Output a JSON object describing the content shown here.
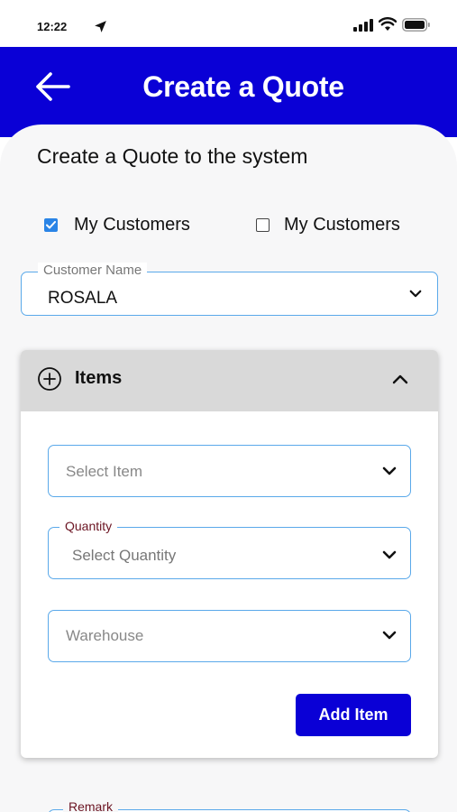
{
  "status_bar": {
    "time": "12:22"
  },
  "header": {
    "title": "Create a Quote"
  },
  "intro": {
    "text": "Create a Quote to the system"
  },
  "filters": [
    {
      "label": "My Customers",
      "checked": true
    },
    {
      "label": "My Customers",
      "checked": false
    }
  ],
  "customer": {
    "legend": "Customer Name",
    "value": "ROSALA"
  },
  "items": {
    "title": "Items",
    "select_item": {
      "placeholder": "Select Item"
    },
    "quantity": {
      "legend": "Quantity",
      "placeholder": "Select Quantity"
    },
    "warehouse": {
      "placeholder": "Warehouse"
    },
    "add_button": "Add Item"
  },
  "remark": {
    "legend": "Remark"
  },
  "colors": {
    "brand_blue": "#0a00d6",
    "field_border": "#5aa9ea",
    "checkbox_blue": "#2a84e6",
    "legend_maroon": "#6b1422"
  }
}
